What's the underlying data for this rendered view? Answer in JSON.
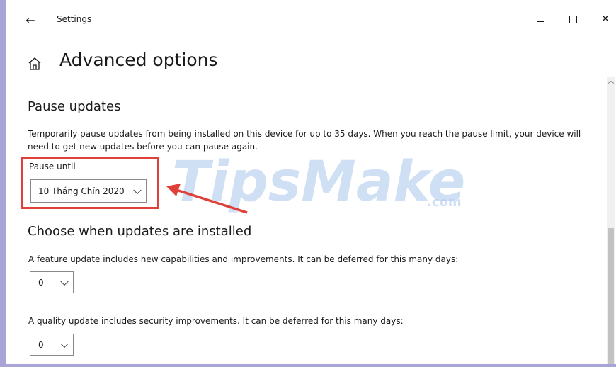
{
  "window": {
    "title": "Settings",
    "back_glyph": "←",
    "close_glyph": "✕"
  },
  "page": {
    "title": "Advanced options",
    "home_icon": "home-icon"
  },
  "pause": {
    "section_title": "Pause updates",
    "description": "Temporarily pause updates from being installed on this device for up to 35 days. When you reach the pause limit, your device will need to get new updates before you can pause again.",
    "label": "Pause until",
    "selected": "10 Tháng Chín 2020"
  },
  "choose": {
    "section_title": "Choose when updates are installed",
    "feature_text": "A feature update includes new capabilities and improvements. It can be deferred for this many days:",
    "feature_value": "0",
    "quality_text": "A quality update includes security improvements. It can be deferred for this many days:",
    "quality_value": "0"
  },
  "watermark": {
    "text": "TipsMake",
    "suffix": ".com",
    "color": "#a9c7ee"
  },
  "colors": {
    "highlight": "#e0403a",
    "text": "#1a1a1a"
  }
}
